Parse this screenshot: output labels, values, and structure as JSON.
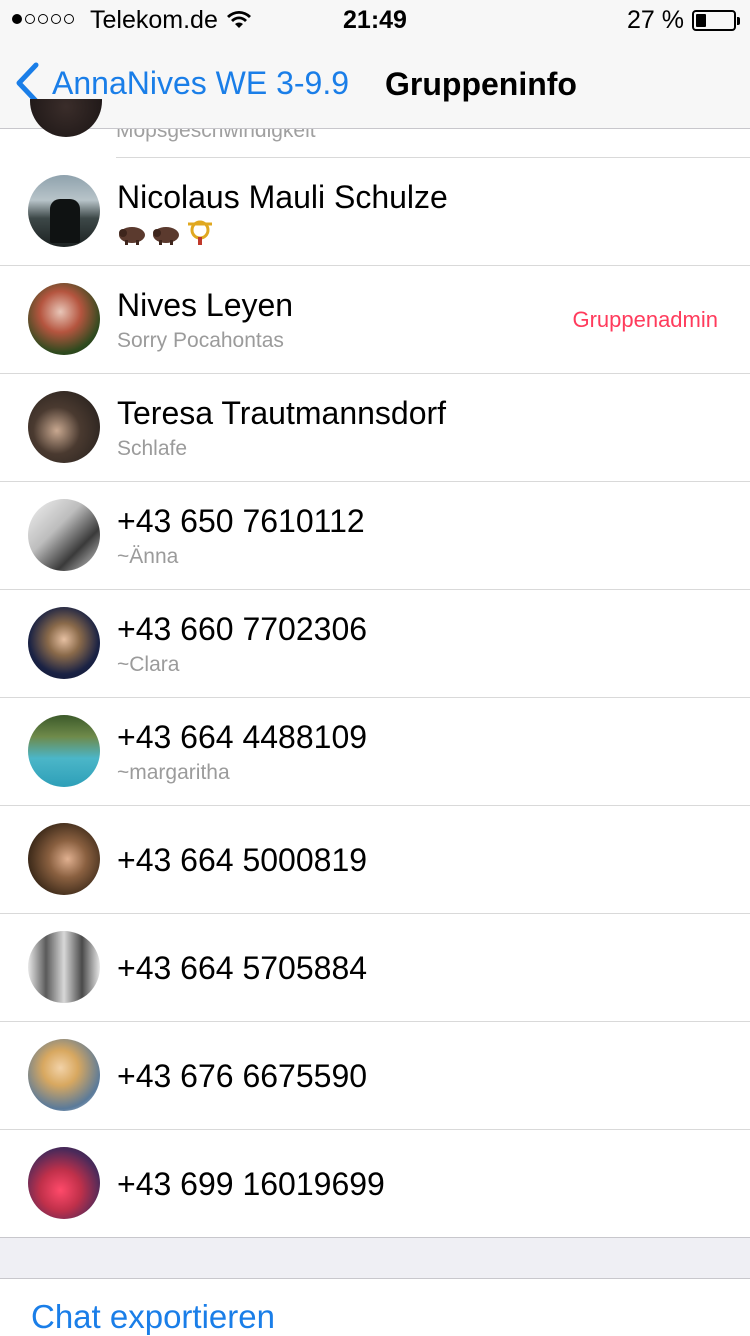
{
  "status_bar": {
    "carrier": "Telekom.de",
    "time": "21:49",
    "battery_percent": "27 %",
    "battery_level": 0.27,
    "signal_bars_filled": 1,
    "signal_bars_total": 5
  },
  "nav": {
    "back_label": "AnnaNives WE 3-9.9",
    "title": "Gruppeninfo"
  },
  "participants": [
    {
      "name": "Nicolaus Mauli Schulze",
      "status": "",
      "admin": ""
    },
    {
      "name": "Nives Leyen",
      "status": "Sorry Pocahontas",
      "admin": "Gruppenadmin"
    },
    {
      "name": "Teresa Trautmannsdorf",
      "status": "Schlafe",
      "admin": ""
    },
    {
      "name": "+43 650 7610112",
      "status": "~Änna",
      "admin": ""
    },
    {
      "name": "+43 660 7702306",
      "status": "~Clara",
      "admin": ""
    },
    {
      "name": "+43 664 4488109",
      "status": "~margaritha",
      "admin": ""
    },
    {
      "name": "+43 664 5000819",
      "status": "",
      "admin": ""
    },
    {
      "name": "+43 664 5705884",
      "status": "",
      "admin": ""
    },
    {
      "name": "+43 676 6675590",
      "status": "",
      "admin": ""
    },
    {
      "name": "+43 699 16019699",
      "status": "",
      "admin": ""
    }
  ],
  "partial_row": {
    "status": "Mopsgeschwindigkeit"
  },
  "actions": {
    "export_label": "Chat exportieren"
  },
  "colors": {
    "accent": "#1a7ee8",
    "admin": "#ff3b5c",
    "secondary_text": "#9b9b9b"
  }
}
